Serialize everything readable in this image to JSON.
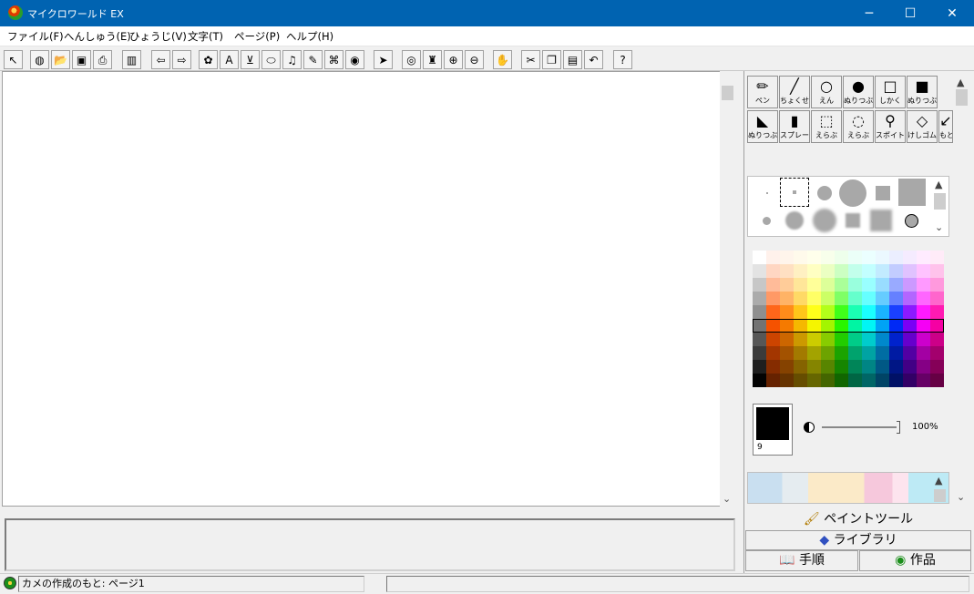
{
  "window": {
    "title": "マイクロワールド EX",
    "controls": {
      "minimize": "─",
      "maximize": "☐",
      "close": "✕"
    }
  },
  "menu": [
    "ファイル(F)",
    "へんしゅう(E)",
    "ひょうじ(V)",
    "文字(T)",
    "ページ(P)",
    "ヘルプ(H)"
  ],
  "toolbar": {
    "buttons": [
      {
        "name": "select-arrow-icon",
        "glyph": "↖"
      },
      {
        "name": "globe-icon",
        "glyph": "◍"
      },
      {
        "name": "open-folder-icon",
        "glyph": "📂"
      },
      {
        "name": "save-icon",
        "glyph": "▣"
      },
      {
        "name": "print-icon",
        "glyph": "⎙"
      },
      {
        "name": "pages-icon",
        "glyph": "▥"
      },
      {
        "name": "back-arrow-icon",
        "glyph": "⇦"
      },
      {
        "name": "forward-arrow-icon",
        "glyph": "⇨"
      },
      {
        "name": "new-turtle-icon",
        "glyph": "✿"
      },
      {
        "name": "text-box-icon",
        "glyph": "A"
      },
      {
        "name": "slider-icon",
        "glyph": "⊻"
      },
      {
        "name": "button-icon",
        "glyph": "⬭"
      },
      {
        "name": "music-icon",
        "glyph": "♫"
      },
      {
        "name": "voice-icon",
        "glyph": "✎"
      },
      {
        "name": "video-icon",
        "glyph": "⌘"
      },
      {
        "name": "web-icon",
        "glyph": "◉"
      },
      {
        "name": "pointer-icon",
        "glyph": "➤"
      },
      {
        "name": "eye-icon",
        "glyph": "◎"
      },
      {
        "name": "stamp-icon",
        "glyph": "♜"
      },
      {
        "name": "zoom-in-icon",
        "glyph": "⊕"
      },
      {
        "name": "zoom-out-icon",
        "glyph": "⊖"
      },
      {
        "name": "stop-hand-icon",
        "glyph": "✋"
      },
      {
        "name": "cut-icon",
        "glyph": "✂"
      },
      {
        "name": "copy-icon",
        "glyph": "❐"
      },
      {
        "name": "paste-icon",
        "glyph": "▤"
      },
      {
        "name": "undo-icon",
        "glyph": "↶"
      },
      {
        "name": "help-icon",
        "glyph": "?"
      }
    ]
  },
  "paint_tools": {
    "row1": [
      {
        "name": "pen-tool",
        "label": "ペン",
        "glyph": "✏"
      },
      {
        "name": "line-tool",
        "label": "ちょくせん",
        "glyph": "╱"
      },
      {
        "name": "circle-tool",
        "label": "えん",
        "glyph": "○"
      },
      {
        "name": "filled-circle-tool",
        "label": "ぬりつぶし",
        "glyph": "●"
      },
      {
        "name": "rectangle-tool",
        "label": "しかく",
        "glyph": "□"
      },
      {
        "name": "filled-rectangle-tool",
        "label": "ぬりつぶし",
        "glyph": "■"
      }
    ],
    "row2": [
      {
        "name": "fill-bucket-tool",
        "label": "ぬりつぶし",
        "glyph": "◣"
      },
      {
        "name": "spray-tool",
        "label": "スプレー",
        "glyph": "▮"
      },
      {
        "name": "select-rect-tool",
        "label": "えらぶ",
        "glyph": "⬚"
      },
      {
        "name": "select-lasso-tool",
        "label": "えらぶ",
        "glyph": "◌"
      },
      {
        "name": "eyedropper-tool",
        "label": "スポイト",
        "glyph": "⚲"
      },
      {
        "name": "eraser-tool",
        "label": "けしゴム",
        "glyph": "◇"
      },
      {
        "name": "restore-tool",
        "label": "もと",
        "glyph": "↙"
      }
    ]
  },
  "current_color": {
    "swatch": "#000000",
    "index": "9"
  },
  "opacity": "100%",
  "tabs": {
    "paint": "ペイントツール",
    "library": "ライブラリ",
    "procedure": "手順",
    "works": "作品"
  },
  "status": {
    "text": "カメの作成のもと: ページ1"
  }
}
